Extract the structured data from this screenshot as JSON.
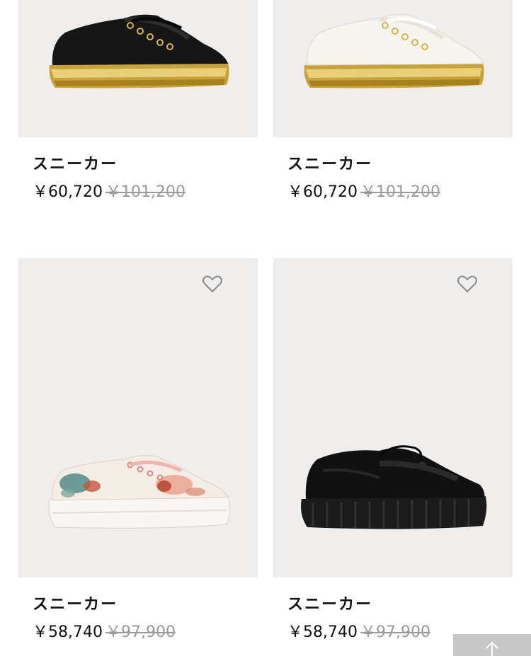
{
  "products": [
    {
      "name": "スニーカー",
      "price": "￥60,720",
      "original_price": "￥101,200",
      "image": "black-leather-sneaker-gold-sole"
    },
    {
      "name": "スニーカー",
      "price": "￥60,720",
      "original_price": "￥101,200",
      "image": "white-leather-sneaker-gold-sole"
    },
    {
      "name": "スニーカー",
      "price": "￥58,740",
      "original_price": "￥97,900",
      "image": "floral-print-sneaker"
    },
    {
      "name": "スニーカー",
      "price": "￥58,740",
      "original_price": "￥97,900",
      "image": "black-runner-sneaker"
    }
  ],
  "icons": {
    "favorite": "heart-outline-icon",
    "back_to_top": "arrow-up-icon"
  },
  "colors": {
    "image_background": "#efeeed",
    "original_price": "#9a9a9a",
    "back_to_top_bg": "#c8c8c8"
  }
}
